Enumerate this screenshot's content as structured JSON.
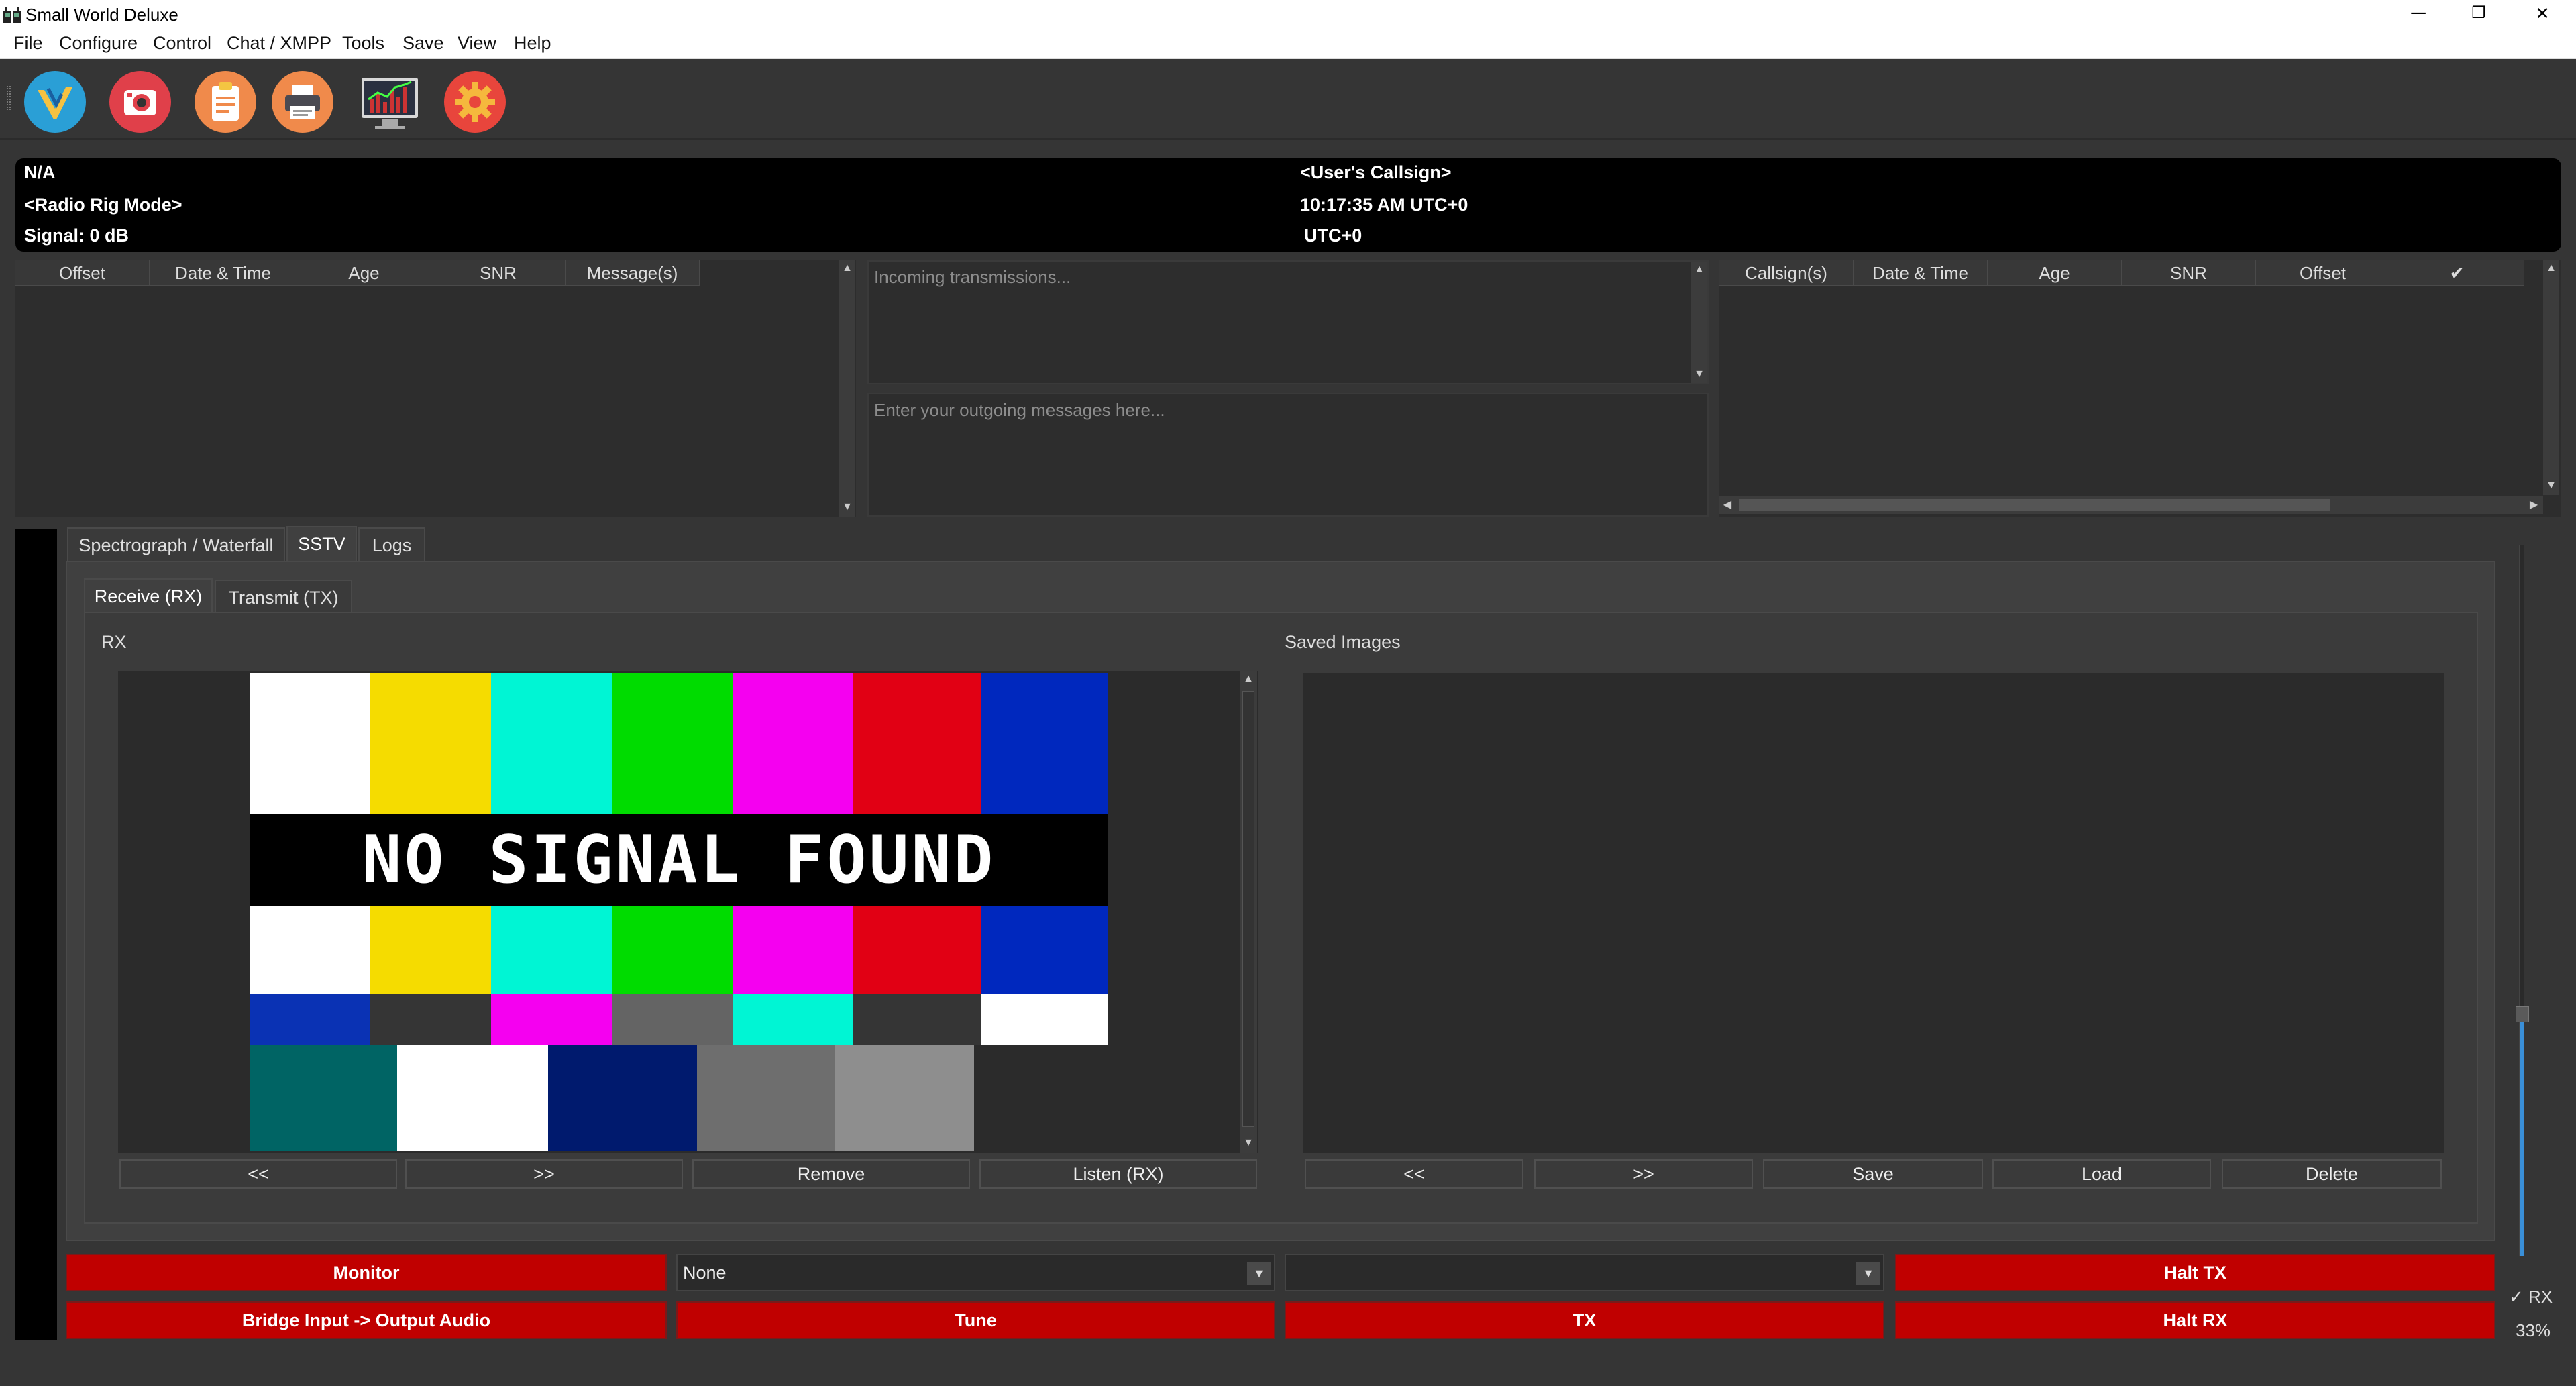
{
  "window": {
    "title": "Small World Deluxe",
    "minimize": "─",
    "maximize": "❐",
    "close": "✕"
  },
  "menu": [
    "File",
    "Configure",
    "Control",
    "Chat / XMPP",
    "Tools",
    "Save",
    "View",
    "Help"
  ],
  "toolbar": {
    "icons": [
      "app-logo-icon",
      "camera-icon",
      "clipboard-icon",
      "printer-icon",
      "spectrum-monitor-icon",
      "settings-gear-icon"
    ]
  },
  "status": {
    "frequency": "N/A",
    "rig_mode": "<Radio Rig Mode>",
    "signal": "Signal: 0 dB",
    "callsign": "<User's Callsign>",
    "time": "10:17:35 AM UTC+0",
    "timezone": "UTC+0"
  },
  "left_table": {
    "headers": [
      "Offset",
      "Date & Time",
      "Age",
      "SNR",
      "Message(s)"
    ]
  },
  "chat": {
    "incoming_placeholder": "Incoming transmissions...",
    "outgoing_placeholder": "Enter your outgoing messages here..."
  },
  "right_table": {
    "headers": [
      "Callsign(s)",
      "Date & Time",
      "Age",
      "SNR",
      "Offset",
      "✔"
    ]
  },
  "tabs": [
    "Spectrograph / Waterfall",
    "SSTV",
    "Logs"
  ],
  "subtabs": [
    "Receive (RX)",
    "Transmit (TX)"
  ],
  "rx": {
    "label": "RX",
    "test_pattern_text": "NO SIGNAL FOUND",
    "buttons": [
      "<<",
      ">>",
      "Remove",
      "Listen (RX)"
    ]
  },
  "saved": {
    "label": "Saved Images",
    "buttons": [
      "<<",
      ">>",
      "Save",
      "Load",
      "Delete"
    ]
  },
  "controls": {
    "monitor": "Monitor",
    "bridge": "Bridge Input -> Output Audio",
    "combo1_value": "None",
    "combo2_value": "",
    "tune": "Tune",
    "tx": "TX",
    "halt_tx": "Halt TX",
    "halt_rx": "Halt RX",
    "rx_check": "✓ RX",
    "volume": "33%"
  },
  "colors": {
    "red_button": "#c00000",
    "accent_blue": "#3a8fd8"
  }
}
